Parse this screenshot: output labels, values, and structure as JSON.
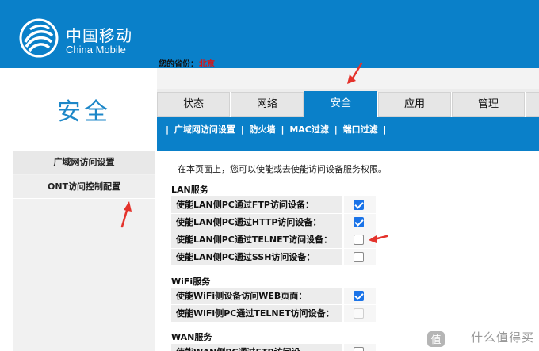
{
  "header": {
    "brand_cn": "中国移动",
    "brand_en": "China Mobile",
    "province_label": "您的省份：",
    "province_value": "北京",
    "bg_color": "#0a80c9"
  },
  "sidebar": {
    "section_title": "安全",
    "items": [
      {
        "label": "广域网访问设置"
      },
      {
        "label": "ONT访问控制配置"
      }
    ]
  },
  "tabs": [
    {
      "label": "状态",
      "active": false
    },
    {
      "label": "网络",
      "active": false
    },
    {
      "label": "安全",
      "active": true
    },
    {
      "label": "应用",
      "active": false
    },
    {
      "label": "管理",
      "active": false
    }
  ],
  "subnav": {
    "items": [
      "广域网访问设置",
      "防火墙",
      "MAC过滤",
      "端口过滤"
    ],
    "separator": "|"
  },
  "content": {
    "intro": "在本页面上，您可以使能或去使能访问设备服务权限。",
    "groups": [
      {
        "title": "LAN服务",
        "rows": [
          {
            "label": "使能LAN侧PC通过FTP访问设备：",
            "checked": true
          },
          {
            "label": "使能LAN侧PC通过HTTP访问设备：",
            "checked": true
          },
          {
            "label": "使能LAN侧PC通过TELNET访问设备：",
            "checked": false
          },
          {
            "label": "使能LAN侧PC通过SSH访问设备：",
            "checked": false
          }
        ]
      },
      {
        "title": "WiFi服务",
        "rows": [
          {
            "label": "使能WiFi侧设备访问WEB页面：",
            "checked": true
          },
          {
            "label": "使能WiFi侧PC通过TELNET访问设备：",
            "checked": false,
            "disabled": true
          }
        ]
      },
      {
        "title": "WAN服务",
        "rows": [
          {
            "label": "使能WAN侧PC通过FTP访问设",
            "checked": false
          }
        ]
      }
    ]
  },
  "watermark": {
    "text": "什么值得买",
    "badge_text": "值"
  },
  "colors": {
    "accent": "#0a80c9",
    "arrow": "#e4322b",
    "checkbox": "#1a73e8"
  }
}
